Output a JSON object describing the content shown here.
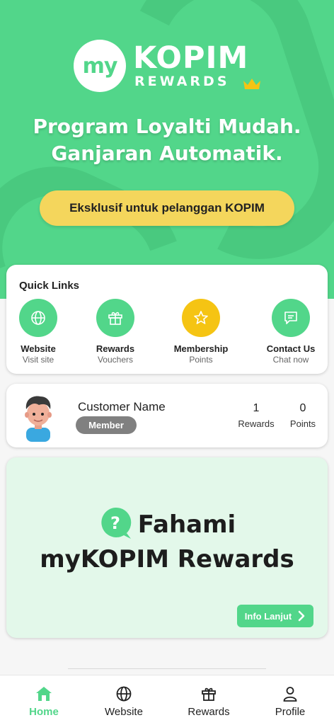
{
  "hero": {
    "logo_circle_text": "my",
    "logo_brand": "KOPIM",
    "logo_sub": "REWARDS",
    "headline_line1": "Program Loyalti Mudah.",
    "headline_line2": "Ganjaran Automatik.",
    "pill_text": "Eksklusif untuk pelanggan KOPIM"
  },
  "quick_links": {
    "title": "Quick Links",
    "items": [
      {
        "label": "Website",
        "sub": "Visit site",
        "icon": "globe-icon"
      },
      {
        "label": "Rewards",
        "sub": "Vouchers",
        "icon": "gift-icon"
      },
      {
        "label": "Membership",
        "sub": "Points",
        "icon": "star-icon"
      },
      {
        "label": "Contact Us",
        "sub": "Chat now",
        "icon": "chat-icon"
      }
    ]
  },
  "customer": {
    "name": "Customer Name",
    "badge": "Member",
    "rewards_count": "1",
    "rewards_label": "Rewards",
    "points_count": "0",
    "points_label": "Points"
  },
  "learn": {
    "line1": "Fahami",
    "line2": "myKOPIM Rewards",
    "button": "Info Lanjut"
  },
  "bottom_nav": {
    "items": [
      {
        "label": "Home",
        "icon": "home-icon",
        "active": true
      },
      {
        "label": "Website",
        "icon": "globe-icon",
        "active": false
      },
      {
        "label": "Rewards",
        "icon": "gift-icon",
        "active": false
      },
      {
        "label": "Profile",
        "icon": "user-icon",
        "active": false
      }
    ]
  },
  "colors": {
    "brand_green": "#52d68a",
    "gold": "#f5c413",
    "pill_yellow": "#f4d65c",
    "badge_gray": "#808080"
  }
}
